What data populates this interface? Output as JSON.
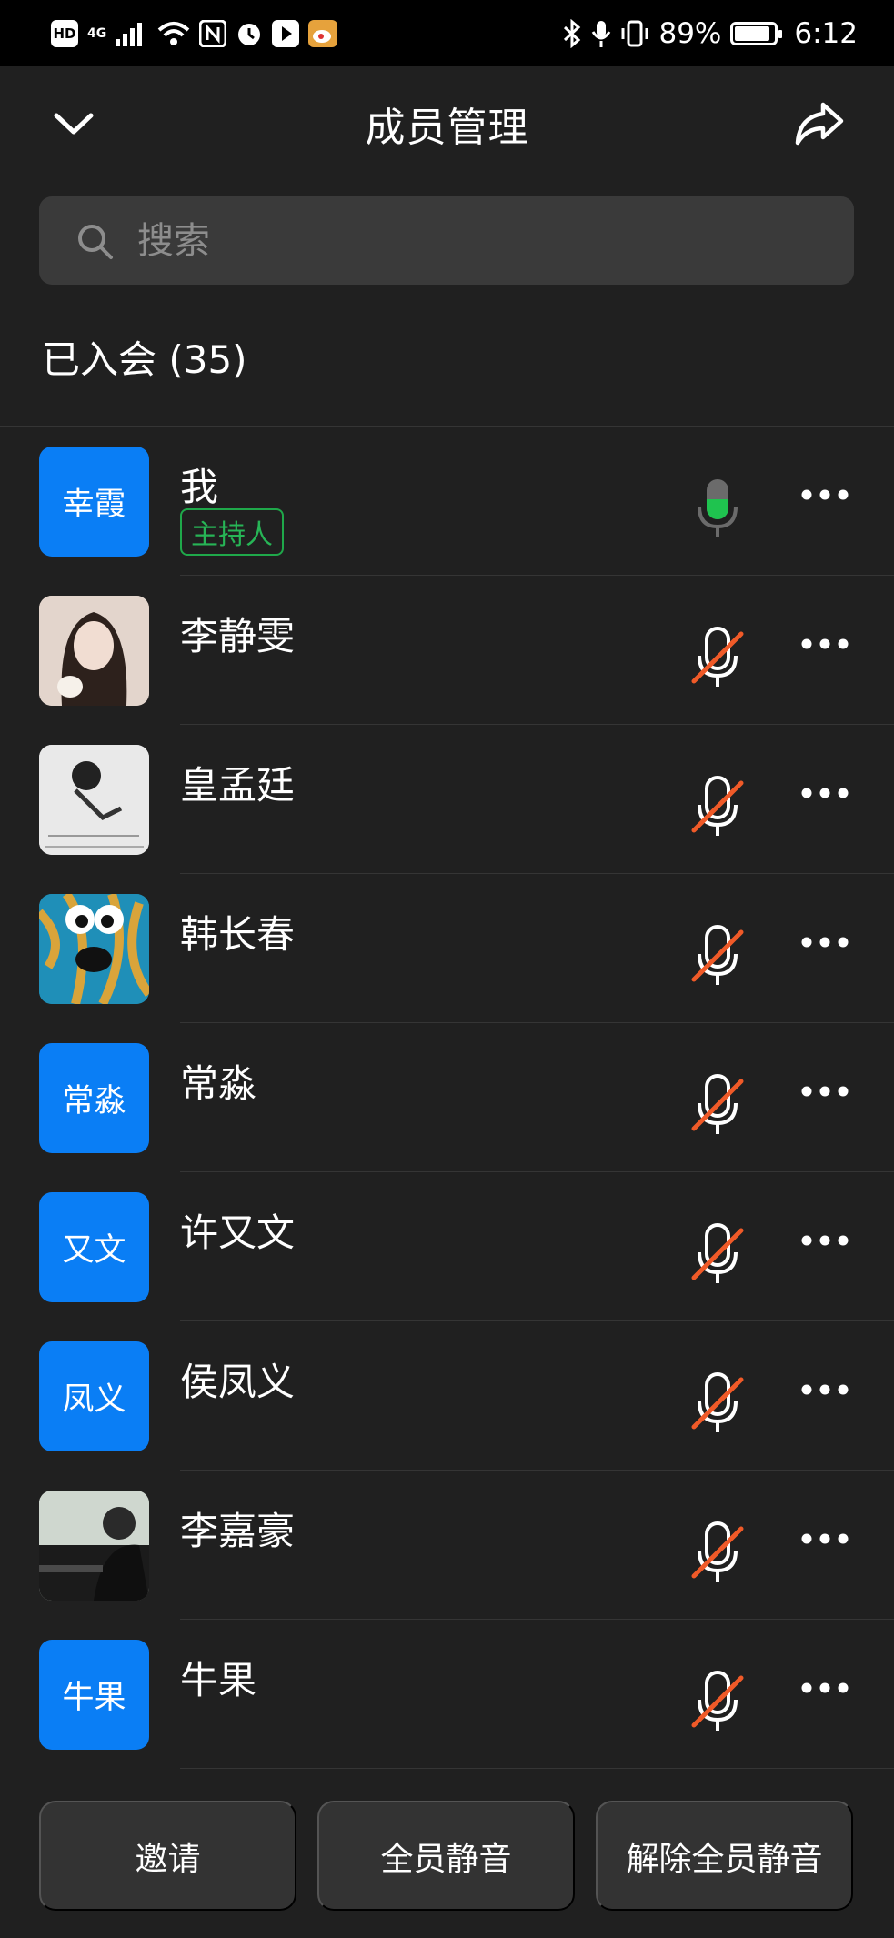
{
  "status_bar": {
    "hd": "HD",
    "network": "4G",
    "battery": "89%",
    "time": "6:12",
    "icons": [
      "signal-icon",
      "wifi-icon",
      "nfc-icon",
      "alarm-icon",
      "play-icon",
      "weibo-icon",
      "bluetooth-icon",
      "mic-icon",
      "vibrate-icon",
      "battery-icon"
    ]
  },
  "header": {
    "title": "成员管理",
    "back_icon": "chevron-down-icon",
    "share_icon": "share-icon"
  },
  "search": {
    "placeholder": "搜索",
    "value": ""
  },
  "section": {
    "title": "已入会 (35)"
  },
  "members": [
    {
      "name": "我",
      "avatar_text": "幸霞",
      "avatar_type": "text",
      "role": "主持人",
      "mic": "on"
    },
    {
      "name": "李静雯",
      "avatar_text": "",
      "avatar_type": "photo",
      "role": "",
      "mic": "muted"
    },
    {
      "name": "皇孟廷",
      "avatar_text": "",
      "avatar_type": "photo",
      "role": "",
      "mic": "muted"
    },
    {
      "name": "韩长春",
      "avatar_text": "",
      "avatar_type": "photo",
      "role": "",
      "mic": "muted"
    },
    {
      "name": "常淼",
      "avatar_text": "常淼",
      "avatar_type": "text",
      "role": "",
      "mic": "muted"
    },
    {
      "name": "许又文",
      "avatar_text": "又文",
      "avatar_type": "text",
      "role": "",
      "mic": "muted"
    },
    {
      "name": "侯凤义",
      "avatar_text": "凤义",
      "avatar_type": "text",
      "role": "",
      "mic": "muted"
    },
    {
      "name": "李嘉豪",
      "avatar_text": "",
      "avatar_type": "photo",
      "role": "",
      "mic": "muted"
    },
    {
      "name": "牛果",
      "avatar_text": "牛果",
      "avatar_type": "text",
      "role": "",
      "mic": "muted"
    }
  ],
  "buttons": {
    "invite": "邀请",
    "mute_all": "全员静音",
    "unmute_all": "解除全员静音"
  },
  "colors": {
    "background": "#202020",
    "avatar_blue": "#0a7ef5",
    "host_green": "#27b556",
    "mic_on_green": "#1fc34f",
    "mute_red": "#f05a28"
  }
}
